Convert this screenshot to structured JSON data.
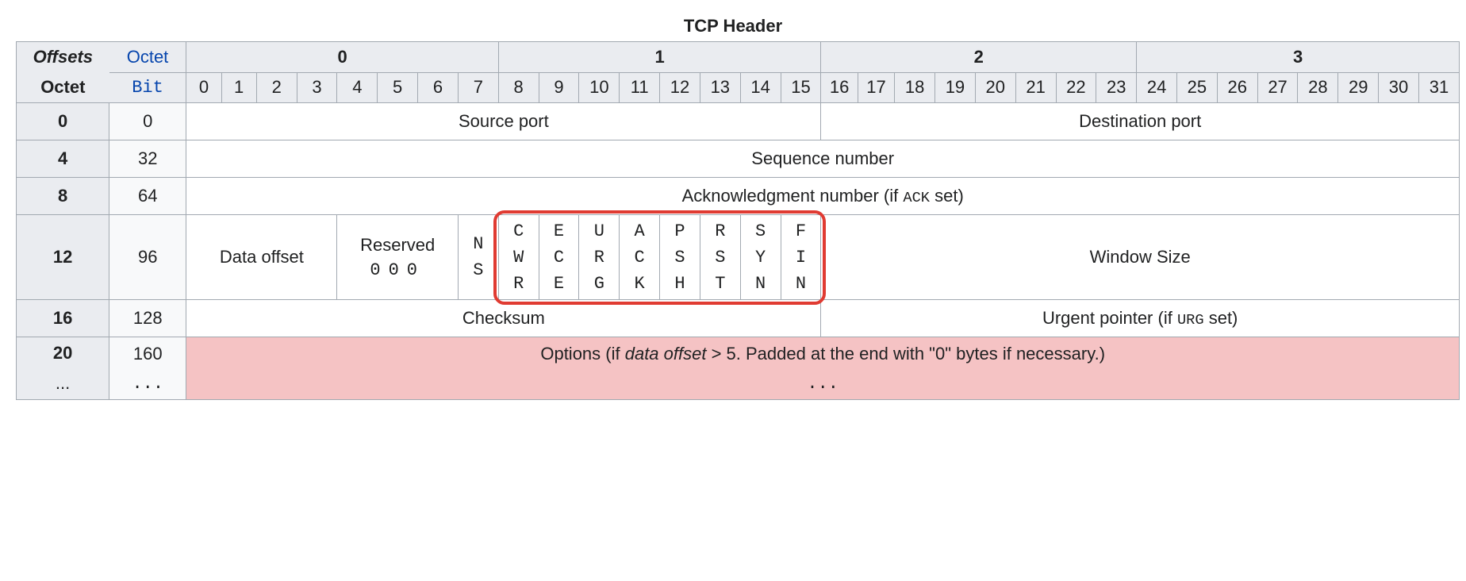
{
  "title": "TCP Header",
  "header": {
    "offsets_label": "Offsets",
    "octet_link": "Octet",
    "octet_row_label": "Octet",
    "bit_link": "Bit",
    "octet_groups": [
      "0",
      "1",
      "2",
      "3"
    ],
    "bits": [
      "0",
      "1",
      "2",
      "3",
      "4",
      "5",
      "6",
      "7",
      "8",
      "9",
      "10",
      "11",
      "12",
      "13",
      "14",
      "15",
      "16",
      "17",
      "18",
      "19",
      "20",
      "21",
      "22",
      "23",
      "24",
      "25",
      "26",
      "27",
      "28",
      "29",
      "30",
      "31"
    ]
  },
  "rows": {
    "r0": {
      "octet": "0",
      "bit": "0",
      "source_port": "Source port",
      "dest_port": "Destination port"
    },
    "r4": {
      "octet": "4",
      "bit": "32",
      "seq": "Sequence number"
    },
    "r8": {
      "octet": "8",
      "bit": "64",
      "ack_prefix": "Acknowledgment number (if ",
      "ack_mono": "ACK",
      "ack_suffix": " set)"
    },
    "r12": {
      "octet": "12",
      "bit": "96",
      "data_offset": "Data offset",
      "reserved_label": "Reserved",
      "reserved_bits": "000",
      "ns_l1": "N",
      "ns_l2": "S",
      "flags": [
        {
          "l1": "C",
          "l2": "W",
          "l3": "R"
        },
        {
          "l1": "E",
          "l2": "C",
          "l3": "E"
        },
        {
          "l1": "U",
          "l2": "R",
          "l3": "G"
        },
        {
          "l1": "A",
          "l2": "C",
          "l3": "K"
        },
        {
          "l1": "P",
          "l2": "S",
          "l3": "H"
        },
        {
          "l1": "R",
          "l2": "S",
          "l3": "T"
        },
        {
          "l1": "S",
          "l2": "Y",
          "l3": "N"
        },
        {
          "l1": "F",
          "l2": "I",
          "l3": "N"
        }
      ],
      "window": "Window Size"
    },
    "r16": {
      "octet": "16",
      "bit": "128",
      "checksum": "Checksum",
      "urg_prefix": "Urgent pointer (if ",
      "urg_mono": "URG",
      "urg_suffix": " set)"
    },
    "r20": {
      "octet": "20",
      "bit": "160",
      "options_a": "Options (if ",
      "options_b": "data offset",
      "options_c": " > 5. Padded at the end with \"0\" bytes if necessary.)",
      "octet2": "...",
      "bit2": "...",
      "dots": "..."
    }
  }
}
